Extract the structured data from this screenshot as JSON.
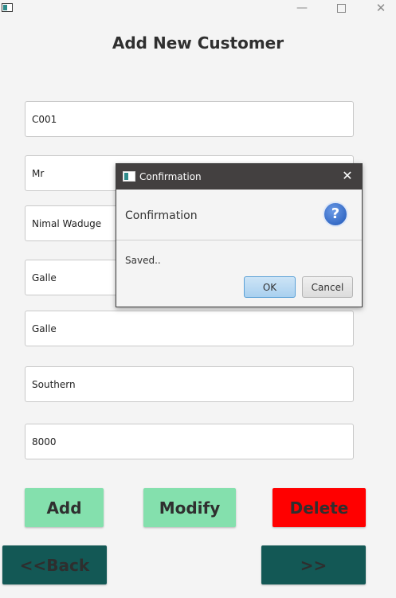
{
  "window": {
    "minimize_glyph": "—",
    "close_glyph": "✕",
    "icons": [
      "app-icon",
      "minimize-icon",
      "maximize-icon",
      "close-icon"
    ]
  },
  "form": {
    "title": "Add New Customer",
    "fields": {
      "customer_id": "C001",
      "title": "Mr",
      "name": "Nimal Waduge",
      "address": "Galle",
      "city": "Galle",
      "province": "Southern",
      "postal_code": "8000"
    }
  },
  "actions": {
    "add_label": "Add",
    "modify_label": "Modify",
    "delete_label": "Delete",
    "back_label": "<<Back",
    "next_label": ">>"
  },
  "dialog": {
    "window_title": "Confirmation",
    "header": "Confirmation",
    "message": "Saved..",
    "question_glyph": "?",
    "close_glyph": "✕",
    "ok_label": "OK",
    "cancel_label": "Cancel",
    "icons": [
      "app-icon",
      "question-icon",
      "close-icon"
    ]
  },
  "colors": {
    "green_button": "#84e0ad",
    "delete_button": "#ff0000",
    "nav_button": "#135855",
    "dialog_titlebar": "#434040",
    "question_icon": "#2f66c8"
  }
}
